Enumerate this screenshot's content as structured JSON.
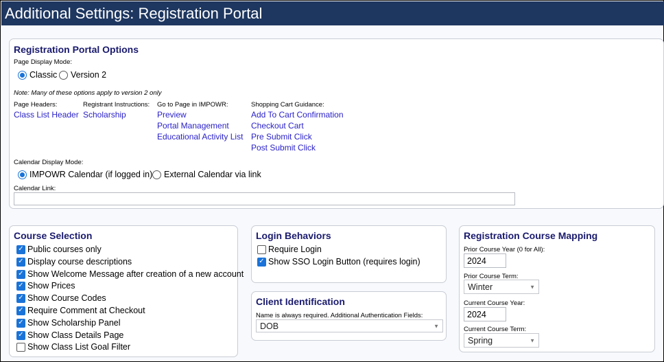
{
  "window": {
    "title": "Additional Settings: Registration Portal"
  },
  "portal_options": {
    "title": "Registration Portal Options",
    "page_display_mode_label": "Page Display Mode:",
    "modes": [
      "Classic",
      "Version 2"
    ],
    "selected_mode": "Classic",
    "note": "Note: Many of these options apply to version 2 only",
    "page_headers": {
      "label": "Page Headers:",
      "links": [
        "Class List Header"
      ]
    },
    "registrant_instructions": {
      "label": "Registrant Instructions:",
      "links": [
        "Scholarship"
      ]
    },
    "go_to_page": {
      "label": "Go to Page in IMPOWR:",
      "links": [
        "Preview",
        "Portal Management",
        "Educational Activity List"
      ]
    },
    "shopping_cart": {
      "label": "Shopping Cart Guidance:",
      "links": [
        "Add To Cart Confirmation",
        "Checkout Cart",
        "Pre Submit Click",
        "Post Submit Click"
      ]
    },
    "calendar_display_mode_label": "Calendar Display Mode:",
    "calendar_modes": [
      "IMPOWR Calendar (if logged in)",
      "External Calendar via link"
    ],
    "selected_calendar_mode": "IMPOWR Calendar (if logged in)",
    "calendar_link_label": "Calendar Link:",
    "calendar_link_value": ""
  },
  "course_selection": {
    "title": "Course Selection",
    "options": [
      {
        "label": "Public courses only",
        "checked": true
      },
      {
        "label": "Display course descriptions",
        "checked": true
      },
      {
        "label": "Show Welcome Message after creation of a new account",
        "checked": true
      },
      {
        "label": "Show Prices",
        "checked": true
      },
      {
        "label": "Show Course Codes",
        "checked": true
      },
      {
        "label": "Require Comment at Checkout",
        "checked": true
      },
      {
        "label": "Show Scholarship Panel",
        "checked": true
      },
      {
        "label": "Show Class Details Page",
        "checked": true
      },
      {
        "label": "Show Class List Goal Filter",
        "checked": false
      }
    ]
  },
  "login_behaviors": {
    "title": "Login Behaviors",
    "options": [
      {
        "label": "Require Login",
        "checked": false
      },
      {
        "label": "Show SSO Login Button (requires login)",
        "checked": true
      }
    ]
  },
  "client_identification": {
    "title": "Client Identification",
    "fields_label": "Name is always required. Additional Authentication Fields:",
    "fields_value": "DOB"
  },
  "course_mapping": {
    "title": "Registration Course Mapping",
    "prior_year_label": "Prior Course Year (0 for All):",
    "prior_year_value": "2024",
    "prior_term_label": "Prior Course Term:",
    "prior_term_value": "Winter",
    "current_year_label": "Current Course Year:",
    "current_year_value": "2024",
    "current_term_label": "Current Course Term:",
    "current_term_value": "Spring"
  },
  "colors": {
    "titlebar": "#1e3760",
    "link": "#2a21c8",
    "heading": "#1a1a6e",
    "accent": "#1a73d8"
  }
}
